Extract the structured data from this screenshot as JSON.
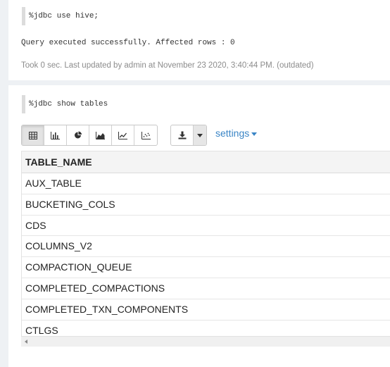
{
  "paragraph1": {
    "code": "%jdbc use hive;",
    "result": "Query executed successfully. Affected rows : 0",
    "footer": "Took 0 sec. Last updated by admin at November 23 2020, 3:40:44 PM. (outdated)"
  },
  "paragraph2": {
    "code": "%jdbc show tables",
    "viz_buttons": [
      {
        "name": "table-icon",
        "active": true
      },
      {
        "name": "bar-chart-icon",
        "active": false
      },
      {
        "name": "pie-chart-icon",
        "active": false
      },
      {
        "name": "area-chart-icon",
        "active": false
      },
      {
        "name": "line-chart-icon",
        "active": false
      },
      {
        "name": "scatter-chart-icon",
        "active": false
      }
    ],
    "settings_label": "settings",
    "table": {
      "header": "TABLE_NAME",
      "rows": [
        "AUX_TABLE",
        "BUCKETING_COLS",
        "CDS",
        "COLUMNS_V2",
        "COMPACTION_QUEUE",
        "COMPLETED_COMPACTIONS",
        "COMPLETED_TXN_COMPONENTS",
        "CTLGS"
      ]
    }
  },
  "colors": {
    "accent": "#3a85c6",
    "background": "#eef1f4"
  }
}
